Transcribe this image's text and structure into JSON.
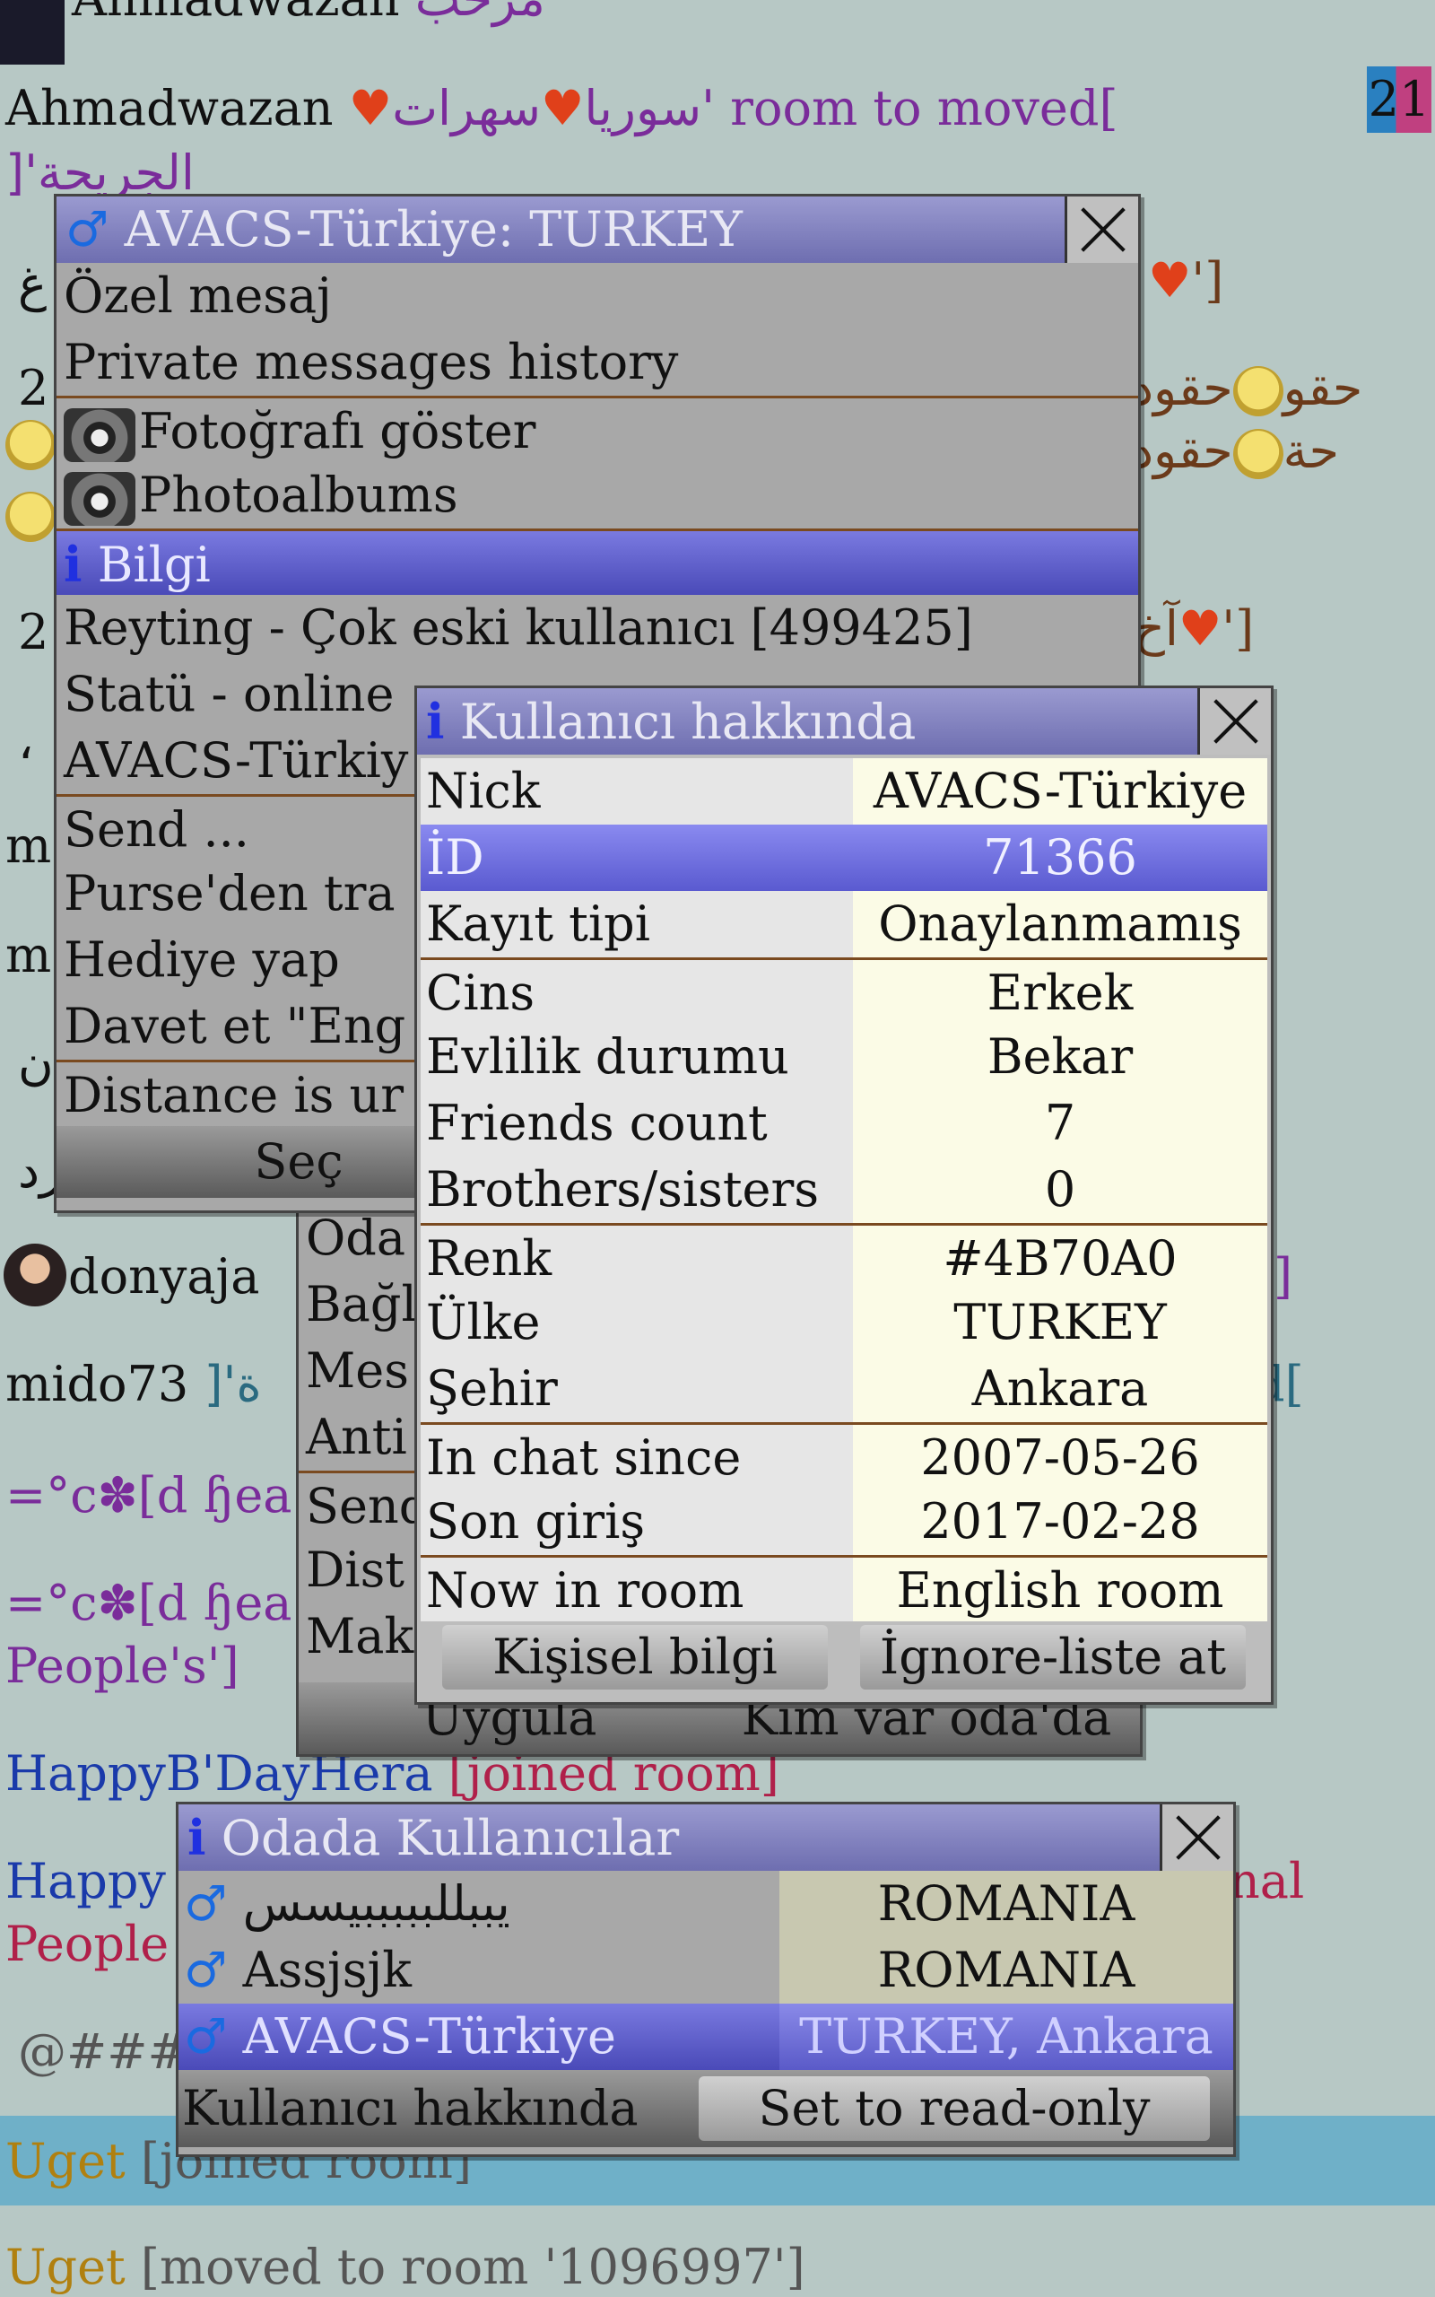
{
  "chat": {
    "line0_name": "Ahmadwazan",
    "line0_ar": "مرحب",
    "line1_name": "Ahmadwazan",
    "line1_ar": "سوريا",
    "line1_ar2": "سهرات'",
    "line1_tail": "room to moved[",
    "line2": "]'الجريحة",
    "line3_frag": "غ",
    "line3_right": "']",
    "line4_frag": "2",
    "line4_right": "حقود",
    "line4_right2": "حقو",
    "line5_right": "حقود",
    "line5_right2": "حة",
    "line6_frag": "2",
    "line6_right": "']",
    "line6_ar": "آخ",
    "line7_frag": "،",
    "line8_frag": "m",
    "line9_frag": "m",
    "line10_frag": "ن",
    "line11_frag": "رد",
    "donya": "donyaja",
    "donya_right": "]",
    "mido": "mido73",
    "mido_ar": "]'ة",
    "mido_right": "d[",
    "flower1": "=°c✽[d ɧea",
    "flower2": "=°c✽[d ɧea",
    "peoples": "People's']",
    "happyb": "HappyB'DayHera",
    "happyb_joined": "[joined room]",
    "happy2": "Happy",
    "happy2_right": "nal",
    "people2": "People",
    "hash": "@###",
    "uget1_name": "Uget",
    "uget1_status": "[joined room]",
    "uget2_name": "Uget",
    "uget2_status": "[moved to room '1096997']",
    "counter": "21"
  },
  "context_menu": {
    "title": "AVACS-Türkiye: TURKEY",
    "items": [
      "Özel mesaj",
      "Private messages history",
      "Fotoğrafı göster",
      "Photoalbums",
      "Bilgi",
      "Reyting - Çok eski kullanıcı [499425]",
      "Statü - online",
      "AVACS-Türkiy",
      "Send ...",
      "Purse'den tra",
      "Hediye yap",
      "Davet et \"Eng",
      "Distance is ur"
    ],
    "select_button": "Seç"
  },
  "room_menu": {
    "items": [
      "Oda",
      "Bağl",
      "Mes",
      "Anti",
      "Send",
      "Dist",
      "Mak"
    ],
    "apply_button": "Uygula",
    "who_button": "Kim var oda'da"
  },
  "info_dialog": {
    "title": "Kullanıcı hakkında",
    "rows": [
      {
        "k": "Nick",
        "v": "AVACS-Türkiye"
      },
      {
        "k": "İD",
        "v": "71366"
      },
      {
        "k": "Kayıt tipi",
        "v": "Onaylanmamış"
      },
      {
        "k": "Cins",
        "v": "Erkek"
      },
      {
        "k": "Evlilik durumu",
        "v": "Bekar"
      },
      {
        "k": "Friends count",
        "v": "7"
      },
      {
        "k": "Brothers/sisters",
        "v": "0"
      },
      {
        "k": "Renk",
        "v": "#4B70A0"
      },
      {
        "k": "Ülke",
        "v": "TURKEY"
      },
      {
        "k": "Şehir",
        "v": "Ankara"
      },
      {
        "k": "In chat since",
        "v": "2007-05-26"
      },
      {
        "k": "Son giriş",
        "v": "2017-02-28"
      },
      {
        "k": "Now in room",
        "v": "English room"
      }
    ],
    "personal_button": "Kişisel bilgi",
    "ignore_button": "İgnore-liste at"
  },
  "room_users": {
    "title": "Odada Kullanıcılar",
    "rows": [
      {
        "name": "يببللبببببيسس",
        "country": "ROMANIA"
      },
      {
        "name": "Assjsjk",
        "country": "ROMANIA"
      },
      {
        "name": "AVACS-Türkiye",
        "country": "TURKEY, Ankara"
      }
    ],
    "about_button": "Kullanıcı hakkında",
    "readonly_button": "Set to read-only"
  },
  "colors": {
    "background": "#b7c8c5",
    "titlebar": "#6e6eb0",
    "selection": "#4a4ab8",
    "separator": "#7a4a20"
  }
}
